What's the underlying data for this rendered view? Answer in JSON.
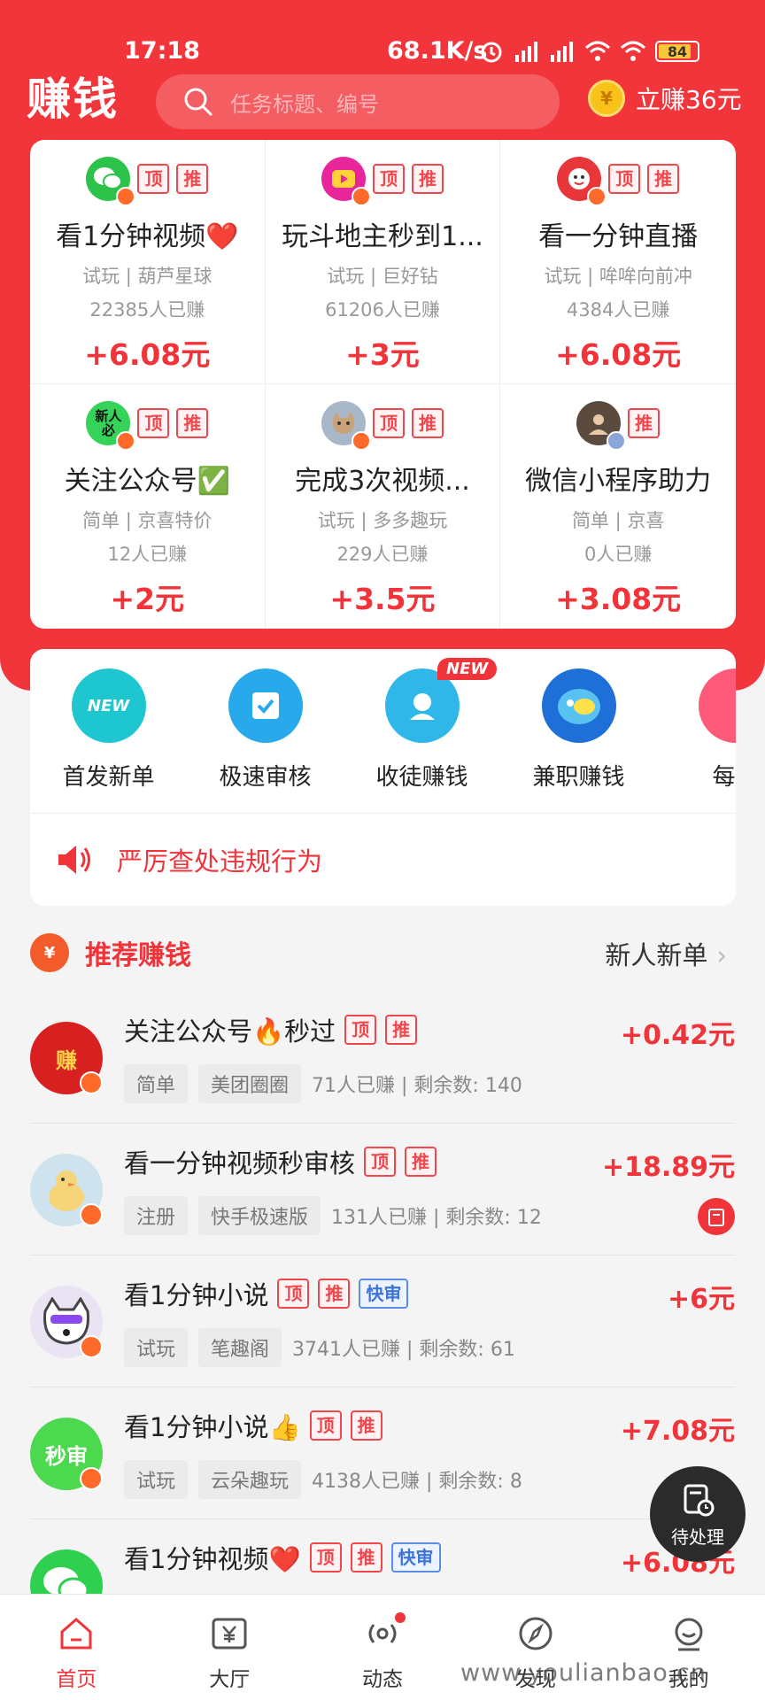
{
  "status_bar": {
    "time": "17:18",
    "network_speed": "68.1K/s",
    "battery": "84"
  },
  "header": {
    "logo": "赚钱",
    "search_placeholder": "任务标题、编号",
    "earn_coin": "¥",
    "earn_label": "立赚36元"
  },
  "featured": [
    {
      "avatar": "wechat",
      "tags": [
        "顶",
        "推"
      ],
      "title": "看1分钟视频❤️",
      "sub": "试玩 | 葫芦星球",
      "count": "22385人已赚",
      "price": "+6.08元"
    },
    {
      "avatar": "video",
      "tags": [
        "顶",
        "推"
      ],
      "title": "玩斗地主秒到1...",
      "sub": "试玩 | 巨好钻",
      "count": "61206人已赚",
      "price": "+3元"
    },
    {
      "avatar": "mascot",
      "tags": [
        "顶",
        "推"
      ],
      "title": "看一分钟直播",
      "sub": "试玩 | 哞哞向前冲",
      "count": "4384人已赚",
      "price": "+6.08元"
    },
    {
      "avatar": "newbie",
      "avatar_text": "新人必",
      "tags": [
        "顶",
        "推"
      ],
      "title": "关注公众号✅",
      "sub": "简单 | 京喜特价",
      "count": "12人已赚",
      "price": "+2元"
    },
    {
      "avatar": "cat",
      "tags": [
        "顶",
        "推"
      ],
      "title": "完成3次视频...",
      "sub": "试玩 | 多多趣玩",
      "count": "229人已赚",
      "price": "+3.5元"
    },
    {
      "avatar": "person",
      "tags": [
        "推"
      ],
      "title": "微信小程序助力",
      "sub": "简单 | 京喜",
      "count": "0人已赚",
      "price": "+3.08元"
    }
  ],
  "categories": [
    {
      "label": "首发新单",
      "icon_text": "NEW",
      "color": "#1ec6d0"
    },
    {
      "label": "极速审核",
      "icon_text": "✓",
      "color": "#27a9ec"
    },
    {
      "label": "收徒赚钱",
      "icon_text": "☺",
      "color": "#2fb7e9",
      "badge": "NEW"
    },
    {
      "label": "兼职赚钱",
      "icon_text": "●",
      "color": "#1f6fd8"
    },
    {
      "label": "每日",
      "icon_text": "",
      "color": "#ff5a7a"
    }
  ],
  "notice": "严厉查处违规行为",
  "recommend": {
    "title": "推荐赚钱",
    "icon_text": "¥",
    "more": "新人新单"
  },
  "tasks": [
    {
      "avatar": "赚",
      "avatar_color": "#d82020",
      "title": "关注公众号🔥秒过",
      "tags": [
        "顶",
        "推"
      ],
      "chips": [
        "简单",
        "美团圈圈"
      ],
      "stats": "71人已赚 | 剩余数: 140",
      "price": "+0.42元"
    },
    {
      "avatar": "",
      "avatar_color": "#f6d57a",
      "title": "看一分钟视频秒审核",
      "tags": [
        "顶",
        "推"
      ],
      "chips": [
        "注册",
        "快手极速版"
      ],
      "stats": "131人已赚 | 剩余数: 12",
      "price": "+18.89元",
      "redbox": true
    },
    {
      "avatar": "",
      "avatar_color": "#7a6ad8",
      "title": "看1分钟小说",
      "tags": [
        "顶",
        "推",
        "快审"
      ],
      "chips": [
        "试玩",
        "笔趣阁"
      ],
      "stats": "3741人已赚 | 剩余数: 61",
      "price": "+6元"
    },
    {
      "avatar": "秒审",
      "avatar_color": "#4cd94f",
      "title": "看1分钟小说👍",
      "tags": [
        "顶",
        "推"
      ],
      "chips": [
        "试玩",
        "云朵趣玩"
      ],
      "stats": "4138人已赚 | 剩余数: 8",
      "price": "+7.08元"
    },
    {
      "avatar": "",
      "avatar_color": "#2fcf4f",
      "title": "看1分钟视频❤️",
      "tags": [
        "顶",
        "推",
        "快审"
      ],
      "chips": [],
      "stats": "",
      "price": "+6.08元"
    }
  ],
  "pending_label": "待处理",
  "nav": [
    {
      "label": "首页",
      "active": true
    },
    {
      "label": "大厅"
    },
    {
      "label": "动态"
    },
    {
      "label": "发现"
    },
    {
      "label": "我的"
    }
  ],
  "watermark": "www.youlianbao.cn"
}
